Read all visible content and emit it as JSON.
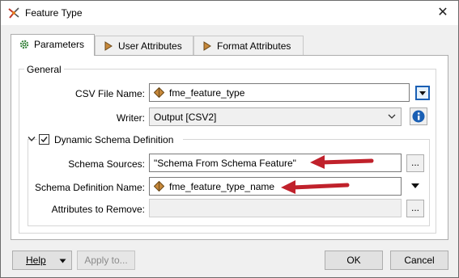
{
  "window": {
    "title": "Feature Type",
    "close_glyph": "✕"
  },
  "tabs": [
    {
      "label": "Parameters",
      "icon": "gear-icon",
      "active": true
    },
    {
      "label": "User Attributes",
      "icon": "right-arrow-icon",
      "active": false
    },
    {
      "label": "Format Attributes",
      "icon": "right-arrow-icon",
      "active": false
    }
  ],
  "general": {
    "title": "General",
    "csv_file_name_label": "CSV File Name:",
    "csv_file_name_value": "fme_feature_type",
    "writer_label": "Writer:",
    "writer_value": "Output [CSV2]"
  },
  "dynamic_schema": {
    "title": "Dynamic Schema Definition",
    "checked": true,
    "schema_sources_label": "Schema Sources:",
    "schema_sources_value": "\"Schema From Schema Feature\"",
    "schema_definition_name_label": "Schema Definition Name:",
    "schema_definition_name_value": "fme_feature_type_name",
    "attributes_to_remove_label": "Attributes to Remove:",
    "attributes_to_remove_value": ""
  },
  "buttons": {
    "ellipsis": "...",
    "help": "Help",
    "apply": "Apply to...",
    "ok": "OK",
    "cancel": "Cancel"
  },
  "colors": {
    "annotation_arrow": "#c0212b",
    "attribute_icon": "#c7883a",
    "accent": "#1a5fb4"
  }
}
